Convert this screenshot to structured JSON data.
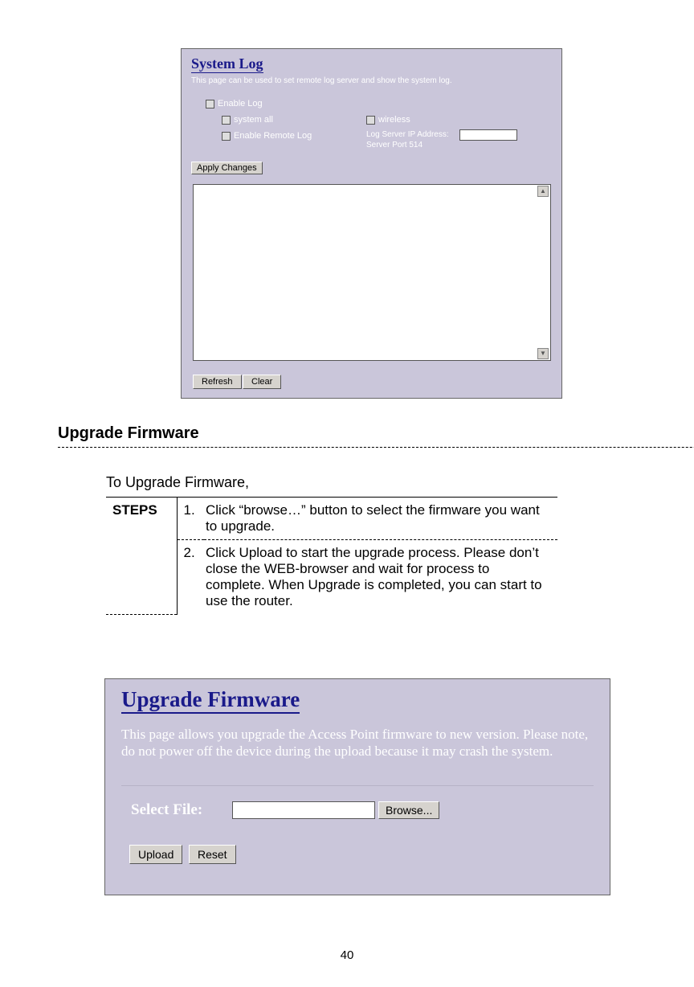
{
  "pageNumber": "40",
  "systemLog": {
    "title": "System Log",
    "desc": "This page can be used to set remote log server and show the system log.",
    "enableLog": "Enable Log",
    "systemAll": "system all",
    "wireless": "wireless",
    "enableRemote": "Enable Remote Log",
    "ipLabelLine1": "Log Server IP Address:",
    "ipLabelLine2": "Server Port  514",
    "ipValue": "",
    "applyBtn": "Apply Changes",
    "textarea": "",
    "refreshBtn": "Refresh",
    "clearBtn": "Clear"
  },
  "heading": "Upgrade Firmware",
  "intro": "To Upgrade Firmware,",
  "steps": {
    "label": "STEPS",
    "items": [
      {
        "num": "1.",
        "text": "Click “browse…” button to select the firmware you want to upgrade."
      },
      {
        "num": "2.",
        "text": "Click Upload to start the upgrade process. Please don’t close the WEB-browser and wait for process to complete. When Upgrade is completed, you can start to use the router."
      }
    ]
  },
  "firmware": {
    "title": "Upgrade Firmware",
    "desc": "This page allows you upgrade the Access Point firmware to new version. Please note, do not power off the device during the upload because it may crash the system.",
    "selectFile": "Select File:",
    "fileValue": "",
    "browseBtn": "Browse...",
    "uploadBtn": "Upload",
    "resetBtn": "Reset"
  }
}
